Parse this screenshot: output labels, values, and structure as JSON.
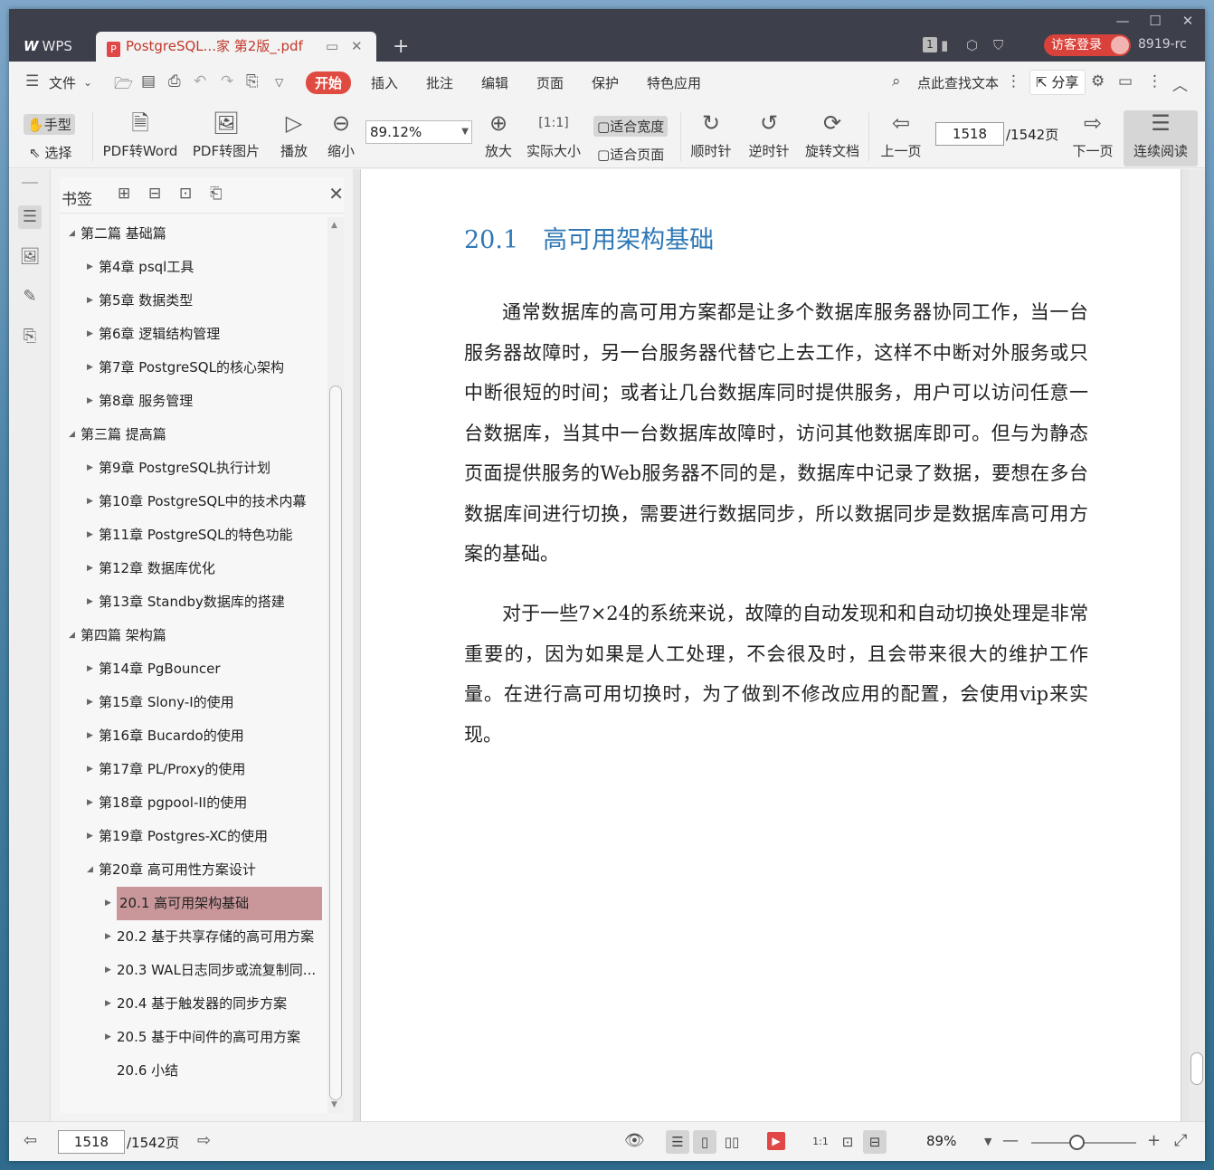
{
  "titlebar": {
    "app_tab": "WPS",
    "app_logo": "W",
    "doc_tab": "PostgreSQL...家 第2版_.pdf",
    "badge": "1",
    "login": "访客登录",
    "user_id": "8919-rc"
  },
  "menu": {
    "file": "文件",
    "tabs": [
      "开始",
      "插入",
      "批注",
      "编辑",
      "页面",
      "保护",
      "特色应用"
    ],
    "search": "点此查找文本",
    "share": "分享"
  },
  "toolbar": {
    "hand": "手型",
    "select": "选择",
    "pdf_to_word": "PDF转Word",
    "pdf_to_image": "PDF转图片",
    "play": "播放",
    "zoom_out": "缩小",
    "zoom_value": "89.12%",
    "zoom_in": "放大",
    "actual_size": "实际大小",
    "fit_width": "适合宽度",
    "fit_page": "适合页面",
    "clockwise": "顺时针",
    "counterclockwise": "逆时针",
    "rotate_doc": "旋转文档",
    "prev_page": "上一页",
    "page_current": "1518",
    "page_total": "/1542页",
    "next_page": "下一页",
    "continuous": "连续阅读"
  },
  "bookmarks": {
    "title": "书签",
    "items": [
      {
        "level": 0,
        "expanded": true,
        "label": "第二篇 基础篇"
      },
      {
        "level": 1,
        "expanded": false,
        "label": "第4章 psql工具"
      },
      {
        "level": 1,
        "expanded": false,
        "label": "第5章 数据类型"
      },
      {
        "level": 1,
        "expanded": false,
        "label": "第6章 逻辑结构管理"
      },
      {
        "level": 1,
        "expanded": false,
        "label": "第7章 PostgreSQL的核心架构"
      },
      {
        "level": 1,
        "expanded": false,
        "label": "第8章 服务管理"
      },
      {
        "level": 0,
        "expanded": true,
        "label": "第三篇 提高篇"
      },
      {
        "level": 1,
        "expanded": false,
        "label": "第9章 PostgreSQL执行计划"
      },
      {
        "level": 1,
        "expanded": false,
        "label": "第10章 PostgreSQL中的技术内幕"
      },
      {
        "level": 1,
        "expanded": false,
        "label": "第11章 PostgreSQL的特色功能"
      },
      {
        "level": 1,
        "expanded": false,
        "label": "第12章 数据库优化"
      },
      {
        "level": 1,
        "expanded": false,
        "label": "第13章 Standby数据库的搭建"
      },
      {
        "level": 0,
        "expanded": true,
        "label": "第四篇 架构篇"
      },
      {
        "level": 1,
        "expanded": false,
        "label": "第14章 PgBouncer"
      },
      {
        "level": 1,
        "expanded": false,
        "label": "第15章 Slony-I的使用"
      },
      {
        "level": 1,
        "expanded": false,
        "label": "第16章 Bucardo的使用"
      },
      {
        "level": 1,
        "expanded": false,
        "label": "第17章 PL/Proxy的使用"
      },
      {
        "level": 1,
        "expanded": false,
        "label": "第18章 pgpool-II的使用"
      },
      {
        "level": 1,
        "expanded": false,
        "label": "第19章 Postgres-XC的使用"
      },
      {
        "level": 1,
        "expanded": true,
        "label": "第20章 高可用性方案设计"
      },
      {
        "level": 2,
        "expanded": false,
        "label": "20.1 高可用架构基础",
        "selected": true
      },
      {
        "level": 2,
        "expanded": false,
        "label": "20.2 基于共享存储的高可用方案"
      },
      {
        "level": 2,
        "expanded": false,
        "label": "20.3 WAL日志同步或流复制同..."
      },
      {
        "level": 2,
        "expanded": false,
        "label": "20.4 基于触发器的同步方案"
      },
      {
        "level": 2,
        "expanded": false,
        "label": "20.5 基于中间件的高可用方案"
      },
      {
        "level": 2,
        "leaf": true,
        "label": "20.6 小结"
      }
    ]
  },
  "document": {
    "heading": "20.1　高可用架构基础",
    "paragraphs": [
      "通常数据库的高可用方案都是让多个数据库服务器协同工作，当一台服务器故障时，另一台服务器代替它上去工作，这样不中断对外服务或只中断很短的时间；或者让几台数据库同时提供服务，用户可以访问任意一台数据库，当其中一台数据库故障时，访问其他数据库即可。但与为静态页面提供服务的Web服务器不同的是，数据库中记录了数据，要想在多台数据库间进行切换，需要进行数据同步，所以数据同步是数据库高可用方案的基础。",
      "对于一些7×24的系统来说，故障的自动发现和和自动切换处理是非常重要的，因为如果是人工处理，不会很及时，且会带来很大的维护工作量。在进行高可用切换时，为了做到不修改应用的配置，会使用vip来实现。"
    ]
  },
  "statusbar": {
    "page_current": "1518",
    "page_total": "/1542页",
    "zoom": "89%"
  },
  "colors": {
    "accent": "#e04b41",
    "heading": "#2f78b5",
    "selected_bookmark": "#c9979a",
    "titlebar": "#3d3f4b"
  }
}
